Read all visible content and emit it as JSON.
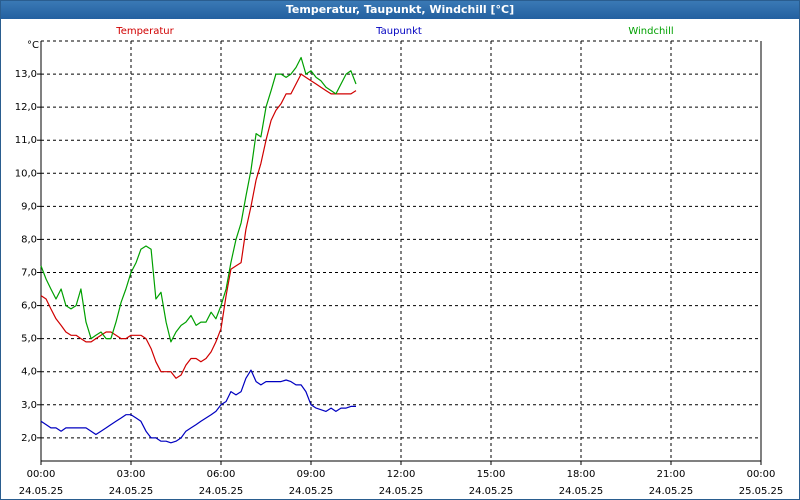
{
  "window": {
    "title": "Temperatur, Taupunkt, Windchill [°C]"
  },
  "chart_data": {
    "type": "line",
    "title": "Temperatur, Taupunkt, Windchill [°C]",
    "ylabel": "°C",
    "ylim": [
      1.3,
      14.0
    ],
    "yticks": [
      "2,0",
      "3,0",
      "4,0",
      "5,0",
      "6,0",
      "7,0",
      "8,0",
      "9,0",
      "10,0",
      "11,0",
      "12,0",
      "13,0"
    ],
    "ytick_values": [
      2,
      3,
      4,
      5,
      6,
      7,
      8,
      9,
      10,
      11,
      12,
      13
    ],
    "xlim": [
      0,
      24
    ],
    "xtick_values": [
      0,
      3,
      6,
      9,
      12,
      15,
      18,
      21,
      24
    ],
    "xticks": [
      {
        "time": "00:00",
        "date": "24.05.25"
      },
      {
        "time": "03:00",
        "date": "24.05.25"
      },
      {
        "time": "06:00",
        "date": "24.05.25"
      },
      {
        "time": "09:00",
        "date": "24.05.25"
      },
      {
        "time": "12:00",
        "date": "24.05.25"
      },
      {
        "time": "15:00",
        "date": "24.05.25"
      },
      {
        "time": "18:00",
        "date": "24.05.25"
      },
      {
        "time": "21:00",
        "date": "24.05.25"
      },
      {
        "time": "00:00",
        "date": "25.05.25"
      }
    ],
    "grid": true,
    "legend_position": "top",
    "series": [
      {
        "name": "Temperatur",
        "color": "#d00000",
        "points": [
          [
            0.0,
            6.3
          ],
          [
            0.17,
            6.2
          ],
          [
            0.33,
            5.9
          ],
          [
            0.5,
            5.6
          ],
          [
            0.67,
            5.4
          ],
          [
            0.83,
            5.2
          ],
          [
            1.0,
            5.1
          ],
          [
            1.17,
            5.1
          ],
          [
            1.33,
            5.0
          ],
          [
            1.5,
            4.9
          ],
          [
            1.67,
            4.9
          ],
          [
            1.83,
            5.0
          ],
          [
            2.0,
            5.1
          ],
          [
            2.17,
            5.2
          ],
          [
            2.33,
            5.2
          ],
          [
            2.5,
            5.1
          ],
          [
            2.67,
            5.0
          ],
          [
            2.83,
            5.0
          ],
          [
            3.0,
            5.1
          ],
          [
            3.17,
            5.1
          ],
          [
            3.33,
            5.1
          ],
          [
            3.5,
            5.0
          ],
          [
            3.67,
            4.7
          ],
          [
            3.83,
            4.3
          ],
          [
            4.0,
            4.0
          ],
          [
            4.17,
            4.0
          ],
          [
            4.33,
            4.0
          ],
          [
            4.5,
            3.8
          ],
          [
            4.67,
            3.9
          ],
          [
            4.83,
            4.2
          ],
          [
            5.0,
            4.4
          ],
          [
            5.17,
            4.4
          ],
          [
            5.33,
            4.3
          ],
          [
            5.5,
            4.4
          ],
          [
            5.67,
            4.6
          ],
          [
            5.83,
            4.9
          ],
          [
            6.0,
            5.3
          ],
          [
            6.17,
            6.3
          ],
          [
            6.33,
            7.1
          ],
          [
            6.5,
            7.2
          ],
          [
            6.67,
            7.3
          ],
          [
            6.83,
            8.3
          ],
          [
            7.0,
            9.0
          ],
          [
            7.17,
            9.8
          ],
          [
            7.33,
            10.3
          ],
          [
            7.5,
            11.0
          ],
          [
            7.67,
            11.6
          ],
          [
            7.83,
            11.9
          ],
          [
            8.0,
            12.1
          ],
          [
            8.17,
            12.4
          ],
          [
            8.33,
            12.4
          ],
          [
            8.5,
            12.7
          ],
          [
            8.67,
            13.0
          ],
          [
            8.83,
            12.9
          ],
          [
            9.0,
            12.8
          ],
          [
            9.17,
            12.7
          ],
          [
            9.33,
            12.6
          ],
          [
            9.5,
            12.5
          ],
          [
            9.67,
            12.4
          ],
          [
            9.83,
            12.4
          ],
          [
            10.0,
            12.4
          ],
          [
            10.17,
            12.4
          ],
          [
            10.33,
            12.4
          ],
          [
            10.5,
            12.5
          ]
        ]
      },
      {
        "name": "Taupunkt",
        "color": "#0000c0",
        "points": [
          [
            0.0,
            2.5
          ],
          [
            0.17,
            2.4
          ],
          [
            0.33,
            2.3
          ],
          [
            0.5,
            2.3
          ],
          [
            0.67,
            2.2
          ],
          [
            0.83,
            2.3
          ],
          [
            1.0,
            2.3
          ],
          [
            1.17,
            2.3
          ],
          [
            1.33,
            2.3
          ],
          [
            1.5,
            2.3
          ],
          [
            1.67,
            2.2
          ],
          [
            1.83,
            2.1
          ],
          [
            2.0,
            2.2
          ],
          [
            2.17,
            2.3
          ],
          [
            2.33,
            2.4
          ],
          [
            2.5,
            2.5
          ],
          [
            2.67,
            2.6
          ],
          [
            2.83,
            2.7
          ],
          [
            3.0,
            2.7
          ],
          [
            3.17,
            2.6
          ],
          [
            3.33,
            2.5
          ],
          [
            3.5,
            2.2
          ],
          [
            3.67,
            2.0
          ],
          [
            3.83,
            2.0
          ],
          [
            4.0,
            1.9
          ],
          [
            4.17,
            1.9
          ],
          [
            4.33,
            1.85
          ],
          [
            4.5,
            1.9
          ],
          [
            4.67,
            2.0
          ],
          [
            4.83,
            2.2
          ],
          [
            5.0,
            2.3
          ],
          [
            5.17,
            2.4
          ],
          [
            5.33,
            2.5
          ],
          [
            5.5,
            2.6
          ],
          [
            5.67,
            2.7
          ],
          [
            5.83,
            2.8
          ],
          [
            6.0,
            3.0
          ],
          [
            6.17,
            3.1
          ],
          [
            6.33,
            3.4
          ],
          [
            6.5,
            3.3
          ],
          [
            6.67,
            3.4
          ],
          [
            6.83,
            3.8
          ],
          [
            7.0,
            4.05
          ],
          [
            7.17,
            3.7
          ],
          [
            7.33,
            3.6
          ],
          [
            7.5,
            3.7
          ],
          [
            7.67,
            3.7
          ],
          [
            7.83,
            3.7
          ],
          [
            8.0,
            3.7
          ],
          [
            8.17,
            3.75
          ],
          [
            8.33,
            3.7
          ],
          [
            8.5,
            3.6
          ],
          [
            8.67,
            3.6
          ],
          [
            8.83,
            3.4
          ],
          [
            9.0,
            3.0
          ],
          [
            9.17,
            2.9
          ],
          [
            9.33,
            2.85
          ],
          [
            9.5,
            2.8
          ],
          [
            9.67,
            2.9
          ],
          [
            9.83,
            2.8
          ],
          [
            10.0,
            2.9
          ],
          [
            10.17,
            2.9
          ],
          [
            10.33,
            2.95
          ],
          [
            10.5,
            2.95
          ]
        ]
      },
      {
        "name": "Windchill",
        "color": "#00a000",
        "points": [
          [
            0.0,
            7.2
          ],
          [
            0.17,
            6.8
          ],
          [
            0.33,
            6.5
          ],
          [
            0.5,
            6.2
          ],
          [
            0.67,
            6.5
          ],
          [
            0.83,
            6.0
          ],
          [
            1.0,
            5.9
          ],
          [
            1.17,
            6.0
          ],
          [
            1.33,
            6.5
          ],
          [
            1.5,
            5.5
          ],
          [
            1.67,
            5.0
          ],
          [
            1.83,
            5.1
          ],
          [
            2.0,
            5.2
          ],
          [
            2.17,
            5.0
          ],
          [
            2.33,
            5.0
          ],
          [
            2.5,
            5.5
          ],
          [
            2.67,
            6.1
          ],
          [
            2.83,
            6.5
          ],
          [
            3.0,
            7.0
          ],
          [
            3.17,
            7.3
          ],
          [
            3.33,
            7.7
          ],
          [
            3.5,
            7.8
          ],
          [
            3.67,
            7.7
          ],
          [
            3.83,
            6.2
          ],
          [
            4.0,
            6.4
          ],
          [
            4.17,
            5.5
          ],
          [
            4.33,
            4.9
          ],
          [
            4.5,
            5.2
          ],
          [
            4.67,
            5.4
          ],
          [
            4.83,
            5.5
          ],
          [
            5.0,
            5.7
          ],
          [
            5.17,
            5.4
          ],
          [
            5.33,
            5.5
          ],
          [
            5.5,
            5.5
          ],
          [
            5.67,
            5.8
          ],
          [
            5.83,
            5.6
          ],
          [
            6.0,
            6.0
          ],
          [
            6.17,
            6.5
          ],
          [
            6.33,
            7.3
          ],
          [
            6.5,
            8.0
          ],
          [
            6.67,
            8.5
          ],
          [
            6.83,
            9.3
          ],
          [
            7.0,
            10.1
          ],
          [
            7.17,
            11.2
          ],
          [
            7.33,
            11.1
          ],
          [
            7.5,
            12.0
          ],
          [
            7.67,
            12.5
          ],
          [
            7.83,
            13.0
          ],
          [
            8.0,
            13.0
          ],
          [
            8.17,
            12.9
          ],
          [
            8.33,
            13.0
          ],
          [
            8.5,
            13.2
          ],
          [
            8.67,
            13.5
          ],
          [
            8.83,
            13.0
          ],
          [
            9.0,
            13.1
          ],
          [
            9.17,
            12.9
          ],
          [
            9.33,
            12.8
          ],
          [
            9.5,
            12.6
          ],
          [
            9.67,
            12.5
          ],
          [
            9.83,
            12.4
          ],
          [
            10.0,
            12.7
          ],
          [
            10.17,
            13.0
          ],
          [
            10.33,
            13.1
          ],
          [
            10.5,
            12.7
          ]
        ]
      }
    ]
  }
}
